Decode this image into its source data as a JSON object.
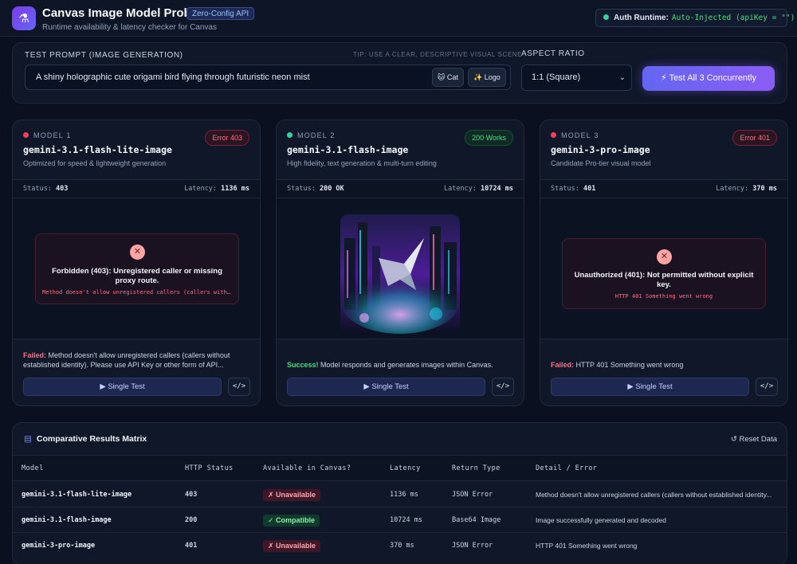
{
  "header": {
    "title": "Canvas Image Model Probe",
    "badge": "Zero-Config API",
    "subtitle": "Runtime availability & latency checker for Canvas",
    "auth_label": "Auth Runtime:",
    "auth_value": "Auto-Injected (apiKey = \"\")"
  },
  "prompt": {
    "label": "TEST PROMPT (IMAGE GENERATION)",
    "tip": "TIP: USE A CLEAR, DESCRIPTIVE VISUAL SCENE",
    "value": "A shiny holographic cute origami bird flying through futuristic neon mist",
    "chip_cat": "🐱 Cat",
    "chip_logo": "✨ Logo",
    "aspect_label": "ASPECT RATIO",
    "aspect_value": "1:1 (Square)",
    "test_all": "⚡ Test All 3 Concurrently"
  },
  "cards": [
    {
      "tag": "MODEL 1",
      "name": "gemini-3.1-flash-lite-image",
      "desc": "Optimized for speed & lightweight generation",
      "badge": "Error 403",
      "status_label": "Status:",
      "status_value": "403",
      "latency_label": "Latency:",
      "latency_value": "1136 ms",
      "error_title": "Forbidden (403): Unregistered caller or missing proxy route.",
      "error_detail": "Method doesn't allow unregistered callers (callers without established identity)",
      "msg_label": "Failed:",
      "msg_text": "Method doesn't allow unregistered callers (callers without established identity). Please use API Key or other form of API...",
      "button": "▶ Single Test",
      "dot": "#f43f5e"
    },
    {
      "tag": "MODEL 2",
      "name": "gemini-3.1-flash-image",
      "desc": "High fidelity, text generation & multi-turn editing",
      "badge": "200 Works",
      "status_label": "Status:",
      "status_value": "200 OK",
      "latency_label": "Latency:",
      "latency_value": "10724 ms",
      "msg_label": "Success!",
      "msg_text": "Model responds and generates images within Canvas.",
      "button": "▶ Single Test",
      "dot": "#34d399"
    },
    {
      "tag": "MODEL 3",
      "name": "gemini-3-pro-image",
      "desc": "Candidate Pro-tier visual model",
      "badge": "Error 401",
      "status_label": "Status:",
      "status_value": "401",
      "latency_label": "Latency:",
      "latency_value": "370 ms",
      "error_title": "Unauthorized (401): Not permitted without explicit key.",
      "error_detail": "HTTP 401 Something went wrong",
      "msg_label": "Failed:",
      "msg_text": "HTTP 401 Something went wrong",
      "button": "▶ Single Test",
      "dot": "#f43f5e"
    }
  ],
  "matrix": {
    "title": "Comparative Results Matrix",
    "reset": "Reset Data",
    "headers": [
      "Model",
      "HTTP Status",
      "Available in Canvas?",
      "Latency",
      "Return Type",
      "Detail / Error"
    ],
    "rows": [
      {
        "model": "gemini-3.1-flash-lite-image",
        "status": "403",
        "available": "✗ Unavailable",
        "latency": "1136 ms",
        "type": "JSON Error",
        "detail": "Method doesn't allow unregistered callers (callers without established identity..."
      },
      {
        "model": "gemini-3.1-flash-image",
        "status": "200",
        "available": "✓ Compatible",
        "latency": "10724 ms",
        "type": "Base64 Image",
        "detail": "Image successfully generated and decoded"
      },
      {
        "model": "gemini-3-pro-image",
        "status": "401",
        "available": "✗ Unavailable",
        "latency": "370 ms",
        "type": "JSON Error",
        "detail": "HTTP 401 Something went wrong"
      }
    ]
  },
  "colors": {
    "error": "#fb7185",
    "success": "#4ade80",
    "accent": "#8b5cf6"
  }
}
